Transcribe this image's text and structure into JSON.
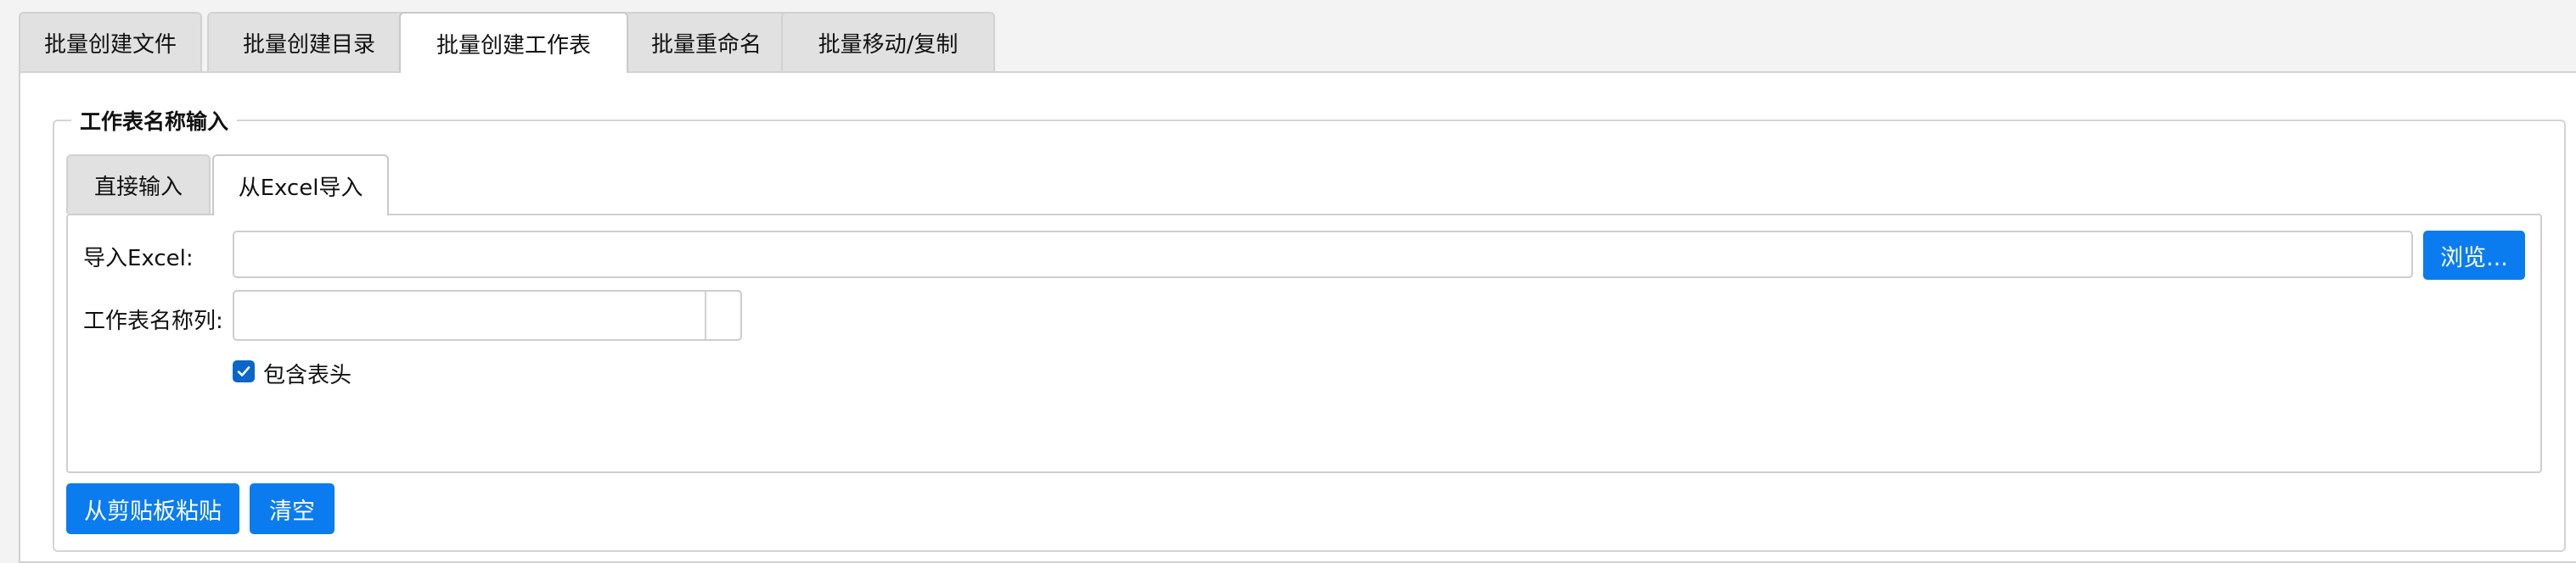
{
  "top_tabs": [
    {
      "label": "批量创建文件",
      "active": false
    },
    {
      "label": "批量创建目录",
      "active": false
    },
    {
      "label": "批量创建工作表",
      "active": true
    },
    {
      "label": "批量重命名",
      "active": false
    },
    {
      "label": "批量移动/复制",
      "active": false
    }
  ],
  "group": {
    "title": "工作表名称输入",
    "inner_tabs": [
      {
        "label": "直接输入",
        "active": false
      },
      {
        "label": "从Excel导入",
        "active": true
      }
    ],
    "import_excel": {
      "label": "导入Excel:",
      "value": "",
      "browse_label": "浏览..."
    },
    "sheet_column": {
      "label": "工作表名称列:",
      "value": ""
    },
    "include_header": {
      "label": "包含表头",
      "checked": true
    }
  },
  "actions": {
    "paste_label": "从剪贴板粘贴",
    "clear_label": "清空"
  },
  "colors": {
    "accent": "#0a7cf0",
    "checkbox": "#0a66c8",
    "tab_inactive": "#e1e1e1",
    "background": "#f3f3f3"
  }
}
